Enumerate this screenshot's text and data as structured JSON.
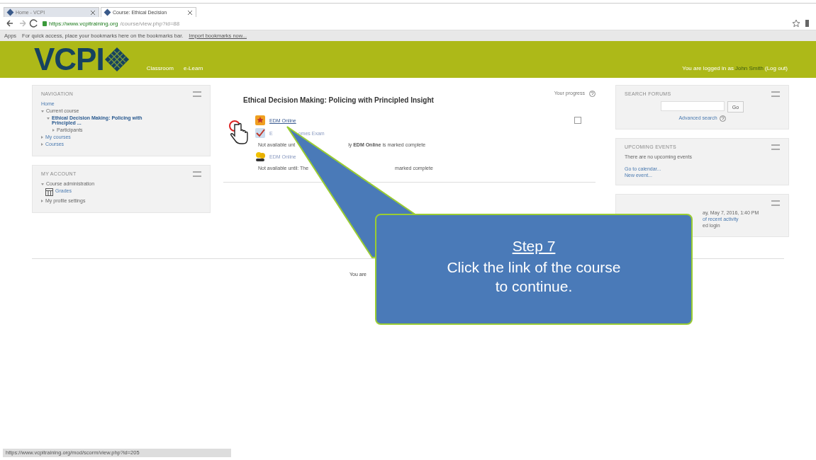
{
  "browser": {
    "tabs": [
      {
        "label": "Home - VCPI",
        "selected": false
      },
      {
        "label": "Course: Ethical Decision",
        "selected": true
      }
    ],
    "url_host": "https://www.vcpitraining.org",
    "url_path": "/course/view.php?id=88",
    "bookmarks_apps": "Apps",
    "bookmarks_hint": "For quick access, place your bookmarks here on the bookmarks bar.",
    "bookmarks_import": "Import bookmarks now..."
  },
  "header": {
    "logo": "VCPI",
    "nav": [
      "Classroom",
      "e-Learn"
    ],
    "login_text": "You are logged in as",
    "user": "John Smith",
    "logout": "(Log out)"
  },
  "navigation": {
    "title": "NAVIGATION",
    "items": [
      {
        "label": "Home",
        "link": true
      },
      {
        "label": "Current course",
        "link": false,
        "expanded": true,
        "children": [
          {
            "label": "Ethical Decision Making: Policing with Principled ...",
            "link": true,
            "expanded": true,
            "children": [
              {
                "label": "Participants",
                "link": false,
                "expanded": false
              }
            ]
          }
        ]
      },
      {
        "label": "My courses",
        "link": true,
        "expanded": false
      },
      {
        "label": "Courses",
        "link": true,
        "expanded": false
      }
    ]
  },
  "my_account": {
    "title": "MY ACCOUNT",
    "items": [
      {
        "label": "Course administration",
        "kind": "folder",
        "expanded": true
      },
      {
        "label": "Grades",
        "kind": "grades"
      },
      {
        "label": "My profile settings",
        "kind": "folder",
        "expanded": false
      }
    ]
  },
  "course": {
    "title": "Ethical Decision Making: Policing with Principled Insight",
    "progress_label": "Your progress",
    "activities": [
      {
        "kind": "scorm",
        "title": [
          "EDM Online"
        ],
        "complete": false
      },
      {
        "kind": "quiz",
        "title": [
          "E",
          "omes Exam"
        ],
        "condition": [
          "Not available unt",
          "ly **EDM Online** is marked complete"
        ]
      },
      {
        "kind": "feedback",
        "title": [
          "EDM Online"
        ],
        "condition": [
          "Not available until: The",
          "marked complete"
        ]
      }
    ]
  },
  "search_forums": {
    "title": "SEARCH FORUMS",
    "button": "Go",
    "advanced": "Advanced search"
  },
  "upcoming_events": {
    "title": "UPCOMING EVENTS",
    "text": "There are no upcoming events",
    "links": [
      "Go to calendar...",
      "New event..."
    ]
  },
  "recent_activity": {
    "lines": [
      "ay, May 7, 2016, 1:40 PM",
      "of recent activity",
      "ed login"
    ]
  },
  "footer": {
    "text": "You are"
  },
  "callout": {
    "step": "Step 7",
    "text": "Click the link of the course to continue."
  },
  "status_bar": "https://www.vcpitraining.org/mod/scorm/view.php?id=205"
}
